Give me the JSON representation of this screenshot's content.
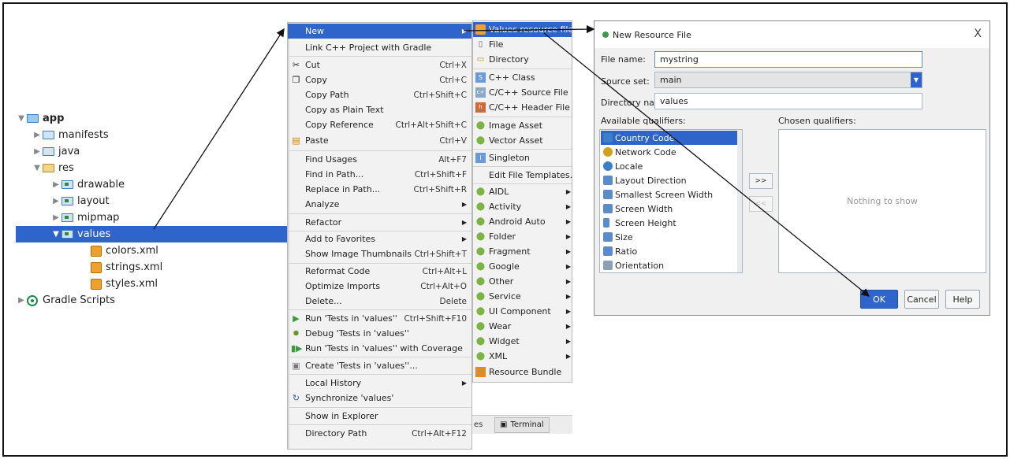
{
  "tree": {
    "items": [
      {
        "label": "app",
        "icon": "app-folder-icon"
      },
      {
        "label": "manifests",
        "icon": "folder-icon"
      },
      {
        "label": "java",
        "icon": "folder-icon"
      },
      {
        "label": "res",
        "icon": "res-folder-icon"
      },
      {
        "label": "drawable",
        "icon": "folder-icon"
      },
      {
        "label": "layout",
        "icon": "folder-icon"
      },
      {
        "label": "mipmap",
        "icon": "folder-icon"
      },
      {
        "label": "values",
        "icon": "folder-icon",
        "selected": true
      },
      {
        "label": "colors.xml",
        "icon": "xml-file-icon"
      },
      {
        "label": "strings.xml",
        "icon": "xml-file-icon"
      },
      {
        "label": "styles.xml",
        "icon": "xml-file-icon"
      },
      {
        "label": "Gradle Scripts",
        "icon": "gradle-icon"
      }
    ]
  },
  "context_menu": {
    "items": [
      {
        "label": "New",
        "shortcut": "",
        "submenu": true
      },
      {
        "label": "Link C++ Project with Gradle",
        "shortcut": ""
      },
      {
        "label": "Cut",
        "shortcut": "Ctrl+X"
      },
      {
        "label": "Copy",
        "shortcut": "Ctrl+C"
      },
      {
        "label": "Copy Path",
        "shortcut": "Ctrl+Shift+C"
      },
      {
        "label": "Copy as Plain Text",
        "shortcut": ""
      },
      {
        "label": "Copy Reference",
        "shortcut": "Ctrl+Alt+Shift+C"
      },
      {
        "label": "Paste",
        "shortcut": "Ctrl+V"
      },
      {
        "label": "Find Usages",
        "shortcut": "Alt+F7"
      },
      {
        "label": "Find in Path...",
        "shortcut": "Ctrl+Shift+F"
      },
      {
        "label": "Replace in Path...",
        "shortcut": "Ctrl+Shift+R"
      },
      {
        "label": "Analyze",
        "shortcut": "",
        "submenu": true
      },
      {
        "label": "Refactor",
        "shortcut": "",
        "submenu": true
      },
      {
        "label": "Add to Favorites",
        "shortcut": "",
        "submenu": true
      },
      {
        "label": "Show Image Thumbnails",
        "shortcut": "Ctrl+Shift+T"
      },
      {
        "label": "Reformat Code",
        "shortcut": "Ctrl+Alt+L"
      },
      {
        "label": "Optimize Imports",
        "shortcut": "Ctrl+Alt+O"
      },
      {
        "label": "Delete...",
        "shortcut": "Delete"
      },
      {
        "label": "Run 'Tests in 'values''",
        "shortcut": "Ctrl+Shift+F10"
      },
      {
        "label": "Debug 'Tests in 'values''",
        "shortcut": ""
      },
      {
        "label": "Run 'Tests in 'values'' with Coverage",
        "shortcut": ""
      },
      {
        "label": "Create 'Tests in 'values''...",
        "shortcut": ""
      },
      {
        "label": "Local History",
        "shortcut": "",
        "submenu": true
      },
      {
        "label": "Synchronize 'values'",
        "shortcut": ""
      },
      {
        "label": "Show in Explorer",
        "shortcut": ""
      },
      {
        "label": "Directory Path",
        "shortcut": "Ctrl+Alt+F12"
      }
    ]
  },
  "new_submenu": {
    "items": [
      {
        "label": "Values resource file"
      },
      {
        "label": "File"
      },
      {
        "label": "Directory"
      },
      {
        "label": "C++ Class"
      },
      {
        "label": "C/C++ Source File"
      },
      {
        "label": "C/C++ Header File"
      },
      {
        "label": "Image Asset"
      },
      {
        "label": "Vector Asset"
      },
      {
        "label": "Singleton"
      },
      {
        "label": "Edit File Templates..."
      },
      {
        "label": "AIDL"
      },
      {
        "label": "Activity"
      },
      {
        "label": "Android Auto"
      },
      {
        "label": "Folder"
      },
      {
        "label": "Fragment"
      },
      {
        "label": "Google"
      },
      {
        "label": "Other"
      },
      {
        "label": "Service"
      },
      {
        "label": "UI Component"
      },
      {
        "label": "Wear"
      },
      {
        "label": "Widget"
      },
      {
        "label": "XML"
      },
      {
        "label": "Resource Bundle"
      }
    ]
  },
  "bottom_strip": {
    "partial_label": "es",
    "terminal_label": "Terminal"
  },
  "dialog": {
    "title": "New Resource File",
    "close_label": "X",
    "file_name_label": "File name:",
    "file_name_value": "mystring",
    "source_set_label": "Source set:",
    "source_set_value": "main",
    "directory_name_label": "Directory name:",
    "directory_name_value": "values",
    "available_label": "Available qualifiers:",
    "chosen_label": "Chosen qualifiers:",
    "nothing_to_show": "Nothing to show",
    "add_button": ">>",
    "remove_button": "<<",
    "qualifiers": [
      "Country Code",
      "Network Code",
      "Locale",
      "Layout Direction",
      "Smallest Screen Width",
      "Screen Width",
      "Screen Height",
      "Size",
      "Ratio",
      "Orientation"
    ],
    "ok_label": "OK",
    "cancel_label": "Cancel",
    "help_label": "Help"
  },
  "colors": {
    "selection": "#2f65ca",
    "android_green": "#7cb342"
  }
}
